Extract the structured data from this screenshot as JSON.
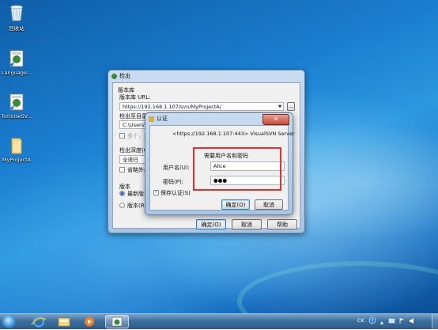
{
  "desktop": {
    "icons": [
      {
        "label": "回收站",
        "icon": "recycle-bin-icon"
      },
      {
        "label": "Language...",
        "icon": "tortoise-language-icon"
      },
      {
        "label": "TortoiseSV...",
        "icon": "tortoisesvn-icon"
      },
      {
        "label": "MyProjectA",
        "icon": "folder-icon"
      }
    ]
  },
  "checkout_window": {
    "title": "检出",
    "repo_group": "版本库",
    "repo_url_label": "版本库 URL:",
    "repo_url_value": "https://192.168.1.107/svn/MyProjectA/",
    "browse_label": "...",
    "checkout_dir_label": "检出至目录",
    "checkout_dir_value": "C:\\Users\\lao",
    "multi_label": "多个，按",
    "depth_label": "检出深度(C)",
    "depth_value": "全递归",
    "omit_externals_label": "省略外部",
    "revision_group": "版本",
    "head_revision_label": "最新版本",
    "revision_label": "版本(R)",
    "ok_label": "确定(O)",
    "cancel_label": "取消",
    "help_label": "帮助"
  },
  "auth_dialog": {
    "title": "认证",
    "realm": "<https://192.168.1.107:443> VisualSVN Server",
    "prompt": "需要用户名和密码",
    "username_label": "用户名(U):",
    "username_value": "Alice",
    "password_label": "密码(P):",
    "password_value": "●●●",
    "save_auth_label": "保存认证(S)",
    "ok_label": "确定(O)",
    "cancel_label": "取消"
  },
  "taskbar": {
    "tray_lang": "CK",
    "colors": {
      "highlight": "#e03030"
    }
  }
}
